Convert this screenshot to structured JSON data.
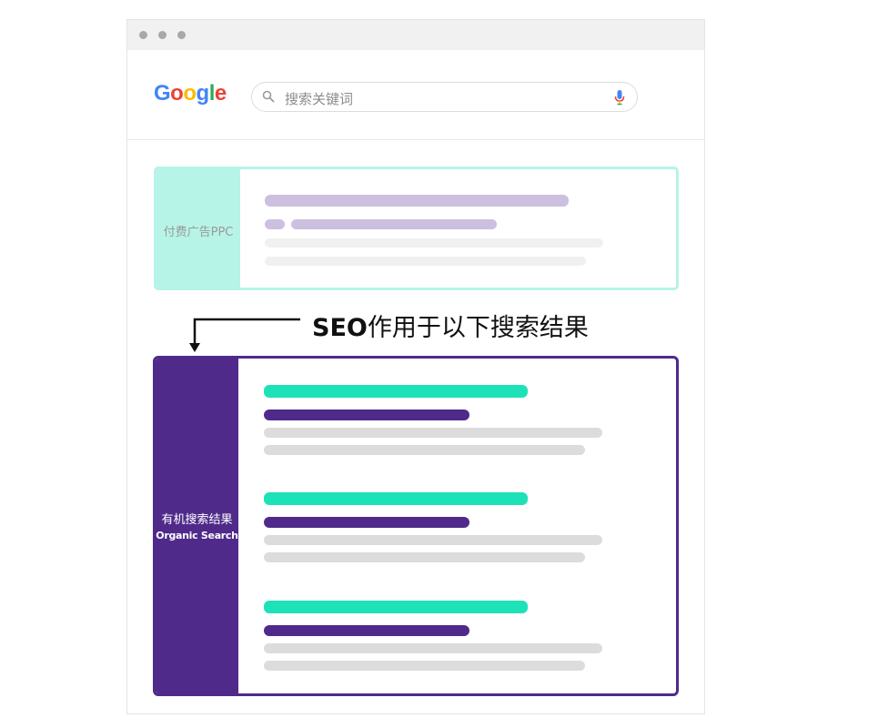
{
  "browser": {
    "logo_text": "Google",
    "logo_colors": [
      "#4285F4",
      "#EA4335",
      "#FBBC05",
      "#4285F4",
      "#34A853",
      "#EA4335"
    ],
    "search_placeholder": "搜索关键词",
    "icons": [
      "search-icon",
      "mic-icon"
    ]
  },
  "ppc_block": {
    "label": "付费广告PPC",
    "side_color": "#b6f4e7",
    "bar_color_title": "#cdbfe0",
    "bar_color_text": "#f0f0f0"
  },
  "annotation": {
    "text": "SEO作用于以下搜索结果",
    "icon": "arrow-down-left"
  },
  "organic_block": {
    "label_cn": "有机搜索结果",
    "label_en": "Organic Search",
    "side_color": "#4f2a8a",
    "bar_color_title": "#1de2b7",
    "bar_color_url": "#4f2a8a",
    "bar_color_text": "#dcdcdc",
    "result_count": 3
  }
}
